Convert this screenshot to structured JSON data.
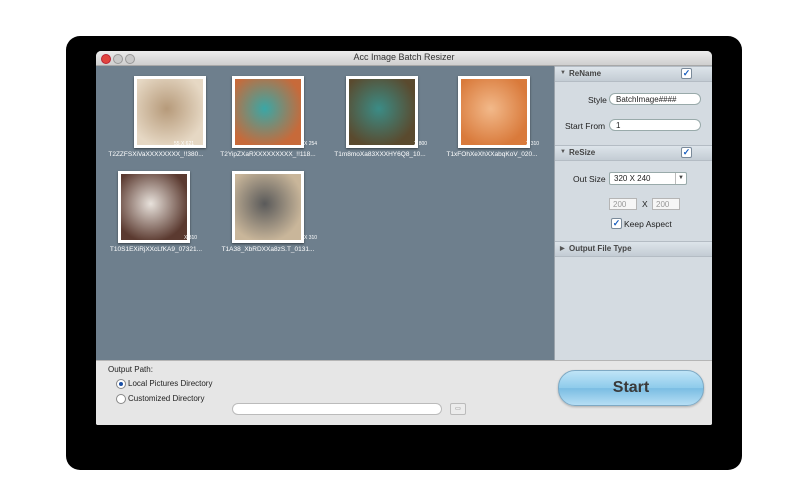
{
  "window": {
    "title": "Acc Image Batch Resizer"
  },
  "gallery": {
    "items": [
      {
        "name": "T2ZZFSXiVaXXXXXXXX_!!380...",
        "dims": "55 X 621",
        "colors": [
          "#e6d8c4",
          "#b69a7a"
        ]
      },
      {
        "name": "T2YipZXaRXXXXXXXXX_!!118...",
        "dims": "X 254",
        "colors": [
          "#c76a3a",
          "#3aa7a6"
        ]
      },
      {
        "name": "T1m8moXa83XXXHY6Q8_10...",
        "dims": "X 800",
        "colors": [
          "#5a4a2e",
          "#3b8c86"
        ]
      },
      {
        "name": "T1xFOhXeXhXXabqKoV_020...",
        "dims": "X 310",
        "colors": [
          "#d97a3b",
          "#f2b98a"
        ]
      },
      {
        "name": "T10S1EXiRjXXcLfKA9_07321...",
        "dims": "X 310",
        "colors": [
          "#5b3a30",
          "#e8e2dc"
        ]
      },
      {
        "name": "T1A38_XbRDXXa8zS.T_0131...",
        "dims": "X 310",
        "colors": [
          "#c9b69a",
          "#5a5a5a"
        ]
      }
    ]
  },
  "rename": {
    "header": "ReName",
    "enabled": true,
    "style_label": "Style",
    "style_value": "BatchImage####",
    "start_from_label": "Start From",
    "start_from_value": "1"
  },
  "resize": {
    "header": "ReSize",
    "enabled": true,
    "out_size_label": "Out Size",
    "out_size_value": "320 X 240",
    "width": "200",
    "x_label": "X",
    "height": "200",
    "keep_aspect_label": "Keep Aspect",
    "keep_aspect": true
  },
  "output_file_type": {
    "header": "Output File Type"
  },
  "output": {
    "path_label": "Output Path:",
    "option_local": "Local Pictures Directory",
    "option_custom": "Customized Directory",
    "selected": "local",
    "custom_path": ""
  },
  "start_button": {
    "label": "Start"
  }
}
